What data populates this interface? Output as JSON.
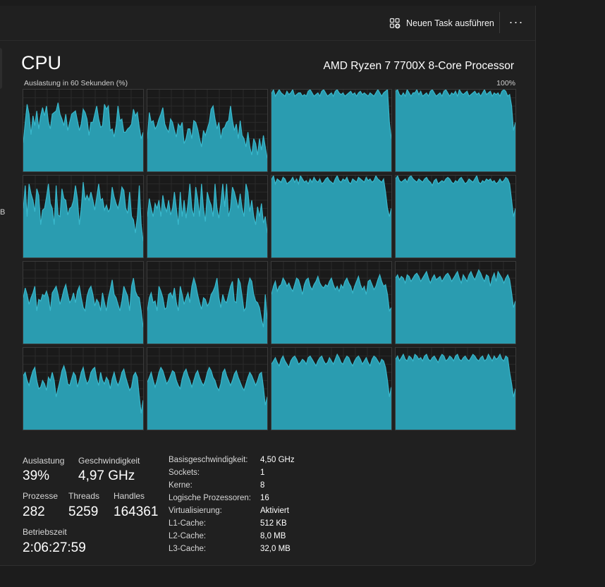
{
  "toolbar": {
    "run_task_label": "Neuen Task ausführen",
    "more_label": "···",
    "run_task_icon": "run-task-icon"
  },
  "sidebar_fragment": "B",
  "page": {
    "title": "CPU",
    "cpu_model": "AMD Ryzen 7 7700X 8-Core Processor",
    "graph_caption": "Auslastung in 60 Sekunden (%)",
    "graph_max": "100%"
  },
  "colors": {
    "graph_fill": "#2a9cb0",
    "graph_line": "#39b8cc",
    "cell_bg": "#1a1a1a",
    "cell_border": "#3a3a3a"
  },
  "chart_data": {
    "type": "area",
    "cores": [
      {
        "values": [
          35,
          60,
          82,
          70,
          45,
          68,
          56,
          74,
          52,
          68,
          78,
          68,
          80,
          60,
          52,
          70,
          72,
          74,
          84,
          70,
          64,
          56,
          70,
          50,
          60,
          70,
          72,
          74,
          62,
          50,
          58,
          76,
          72,
          64,
          44,
          60,
          60,
          70,
          80,
          64,
          54,
          56,
          82,
          76,
          80,
          50,
          52,
          42,
          56,
          80,
          62,
          64,
          48,
          48,
          52,
          54,
          58,
          76,
          68,
          72,
          54,
          40,
          48
        ]
      },
      {
        "values": [
          40,
          72,
          60,
          62,
          52,
          56,
          64,
          70,
          78,
          58,
          52,
          48,
          64,
          60,
          50,
          42,
          58,
          54,
          60,
          34,
          40,
          52,
          52,
          40,
          62,
          60,
          52,
          40,
          30,
          50,
          44,
          52,
          60,
          76,
          80,
          64,
          52,
          60,
          40,
          52,
          54,
          60,
          62,
          80,
          62,
          50,
          58,
          40,
          62,
          44,
          40,
          30,
          48,
          30,
          20,
          40,
          34,
          20,
          40,
          26,
          44,
          30,
          16
        ]
      },
      {
        "values": [
          95,
          100,
          92,
          96,
          100,
          96,
          94,
          92,
          98,
          94,
          96,
          100,
          92,
          94,
          96,
          96,
          92,
          94,
          92,
          98,
          100,
          96,
          92,
          94,
          96,
          92,
          98,
          100,
          96,
          92,
          94,
          96,
          92,
          98,
          100,
          96,
          94,
          96,
          92,
          94,
          96,
          98,
          94,
          96,
          92,
          96,
          98,
          94,
          96,
          94,
          92,
          96,
          94,
          92,
          96,
          100,
          96,
          92,
          96,
          98,
          100,
          60,
          40
        ]
      },
      {
        "values": [
          98,
          100,
          94,
          92,
          96,
          92,
          100,
          96,
          92,
          96,
          96,
          100,
          94,
          98,
          92,
          94,
          96,
          92,
          98,
          100,
          96,
          92,
          94,
          96,
          92,
          98,
          100,
          96,
          92,
          96,
          94,
          98,
          92,
          100,
          96,
          94,
          96,
          98,
          92,
          94,
          96,
          98,
          94,
          96,
          92,
          96,
          100,
          94,
          96,
          98,
          92,
          96,
          94,
          96,
          92,
          98,
          100,
          98,
          92,
          94,
          80,
          50,
          60
        ]
      },
      {
        "values": [
          60,
          88,
          50,
          90,
          78,
          70,
          56,
          84,
          76,
          40,
          58,
          60,
          74,
          90,
          66,
          60,
          40,
          88,
          52,
          50,
          84,
          72,
          70,
          52,
          60,
          62,
          70,
          88,
          72,
          40,
          60,
          92,
          70,
          76,
          70,
          80,
          70,
          58,
          74,
          90,
          70,
          72,
          58,
          64,
          56,
          60,
          86,
          74,
          66,
          60,
          70,
          86,
          82,
          60,
          54,
          80,
          50,
          46,
          30,
          50,
          88,
          40,
          20
        ]
      },
      {
        "values": [
          50,
          72,
          60,
          50,
          66,
          60,
          70,
          50,
          76,
          62,
          56,
          70,
          52,
          60,
          80,
          60,
          40,
          80,
          50,
          70,
          48,
          66,
          90,
          60,
          50,
          86,
          72,
          50,
          90,
          60,
          44,
          80,
          70,
          64,
          50,
          90,
          60,
          48,
          66,
          90,
          62,
          90,
          50,
          60,
          86,
          80,
          70,
          60,
          78,
          60,
          50,
          90,
          80,
          56,
          70,
          50,
          40,
          62,
          50,
          66,
          42,
          50,
          30
        ]
      },
      {
        "values": [
          95,
          100,
          90,
          96,
          94,
          92,
          98,
          96,
          90,
          92,
          94,
          98,
          92,
          96,
          90,
          100,
          96,
          92,
          94,
          90,
          96,
          92,
          98,
          94,
          92,
          96,
          90,
          92,
          96,
          98,
          94,
          92,
          90,
          96,
          100,
          94,
          92,
          96,
          94,
          98,
          92,
          90,
          96,
          94,
          92,
          98,
          96,
          94,
          92,
          98,
          94,
          96,
          92,
          94,
          100,
          96,
          94,
          92,
          96,
          80,
          60,
          50,
          60
        ]
      },
      {
        "values": [
          96,
          100,
          94,
          92,
          94,
          96,
          92,
          98,
          100,
          96,
          94,
          92,
          96,
          94,
          92,
          96,
          98,
          94,
          92,
          88,
          94,
          96,
          90,
          92,
          94,
          92,
          96,
          98,
          96,
          92,
          90,
          94,
          92,
          96,
          98,
          94,
          90,
          92,
          96,
          94,
          92,
          96,
          100,
          92,
          90,
          94,
          92,
          96,
          94,
          96,
          92,
          94,
          90,
          92,
          96,
          92,
          94,
          98,
          96,
          90,
          70,
          50,
          60
        ]
      },
      {
        "values": [
          56,
          68,
          60,
          48,
          56,
          62,
          70,
          40,
          54,
          52,
          60,
          58,
          64,
          56,
          40,
          62,
          66,
          70,
          60,
          48,
          56,
          66,
          72,
          60,
          50,
          54,
          62,
          50,
          64,
          70,
          56,
          44,
          40,
          58,
          66,
          70,
          60,
          46,
          54,
          50,
          40,
          62,
          50,
          40,
          56,
          66,
          78,
          60,
          56,
          48,
          40,
          52,
          70,
          64,
          58,
          40,
          70,
          80,
          64,
          58,
          56,
          40,
          20
        ]
      },
      {
        "values": [
          40,
          56,
          62,
          50,
          52,
          40,
          70,
          64,
          56,
          42,
          44,
          60,
          62,
          56,
          68,
          50,
          40,
          70,
          60,
          48,
          56,
          62,
          50,
          70,
          80,
          72,
          60,
          50,
          42,
          56,
          54,
          46,
          50,
          60,
          64,
          70,
          80,
          56,
          44,
          60,
          52,
          50,
          60,
          70,
          76,
          52,
          50,
          80,
          74,
          58,
          40,
          44,
          70,
          80,
          76,
          60,
          52,
          50,
          44,
          30,
          20,
          60,
          30
        ]
      },
      {
        "values": [
          60,
          70,
          76,
          64,
          70,
          72,
          80,
          76,
          70,
          74,
          68,
          64,
          72,
          80,
          78,
          70,
          60,
          72,
          78,
          80,
          70,
          66,
          72,
          76,
          82,
          74,
          70,
          68,
          72,
          70,
          76,
          80,
          72,
          66,
          70,
          64,
          72,
          68,
          76,
          80,
          74,
          70,
          62,
          70,
          76,
          82,
          72,
          66,
          70,
          60,
          76,
          78,
          72,
          66,
          70,
          78,
          84,
          76,
          70,
          72,
          60,
          40,
          44
        ]
      },
      {
        "values": [
          80,
          84,
          78,
          82,
          80,
          74,
          84,
          82,
          76,
          80,
          84,
          86,
          82,
          76,
          80,
          84,
          88,
          80,
          74,
          80,
          84,
          78,
          80,
          82,
          76,
          80,
          84,
          86,
          82,
          76,
          80,
          84,
          88,
          80,
          74,
          84,
          80,
          76,
          84,
          88,
          82,
          78,
          84,
          90,
          86,
          80,
          76,
          84,
          82,
          70,
          80,
          86,
          76,
          88,
          84,
          80,
          74,
          80,
          84,
          78,
          62,
          44,
          52
        ]
      },
      {
        "values": [
          66,
          70,
          60,
          54,
          64,
          72,
          76,
          60,
          50,
          52,
          60,
          56,
          48,
          64,
          60,
          70,
          60,
          40,
          50,
          60,
          72,
          78,
          70,
          56,
          54,
          62,
          70,
          66,
          52,
          60,
          70,
          76,
          64,
          56,
          60,
          70,
          74,
          76,
          62,
          54,
          70,
          60,
          56,
          64,
          60,
          50,
          62,
          70,
          60,
          54,
          60,
          70,
          74,
          64,
          56,
          48,
          52,
          66,
          70,
          64,
          40,
          20,
          36
        ]
      },
      {
        "values": [
          58,
          64,
          70,
          60,
          52,
          60,
          70,
          76,
          72,
          64,
          56,
          60,
          66,
          72,
          70,
          60,
          54,
          50,
          62,
          70,
          74,
          66,
          60,
          52,
          60,
          68,
          72,
          64,
          58,
          54,
          60,
          70,
          76,
          72,
          64,
          60,
          52,
          48,
          56,
          70,
          74,
          66,
          60,
          54,
          60,
          68,
          72,
          64,
          58,
          52,
          48,
          56,
          64,
          70,
          66,
          60,
          54,
          60,
          68,
          70,
          52,
          30,
          40
        ]
      },
      {
        "values": [
          80,
          84,
          88,
          82,
          78,
          86,
          90,
          84,
          80,
          76,
          84,
          88,
          90,
          86,
          80,
          82,
          86,
          84,
          80,
          88,
          90,
          86,
          82,
          78,
          84,
          88,
          90,
          84,
          80,
          82,
          88,
          84,
          80,
          86,
          92,
          88,
          82,
          80,
          86,
          90,
          88,
          82,
          78,
          84,
          88,
          90,
          86,
          80,
          84,
          88,
          82,
          78,
          86,
          90,
          88,
          84,
          80,
          86,
          84,
          76,
          60,
          40,
          52
        ]
      },
      {
        "values": [
          86,
          90,
          84,
          88,
          92,
          86,
          84,
          90,
          88,
          84,
          92,
          90,
          86,
          88,
          84,
          90,
          92,
          86,
          84,
          88,
          90,
          86,
          82,
          88,
          92,
          90,
          84,
          86,
          90,
          88,
          84,
          90,
          92,
          86,
          84,
          88,
          90,
          86,
          84,
          88,
          92,
          90,
          86,
          84,
          88,
          90,
          84,
          86,
          92,
          88,
          84,
          90,
          86,
          88,
          92,
          86,
          84,
          90,
          88,
          70,
          56,
          40,
          50
        ]
      }
    ]
  },
  "stats": {
    "auslastung": {
      "label": "Auslastung",
      "value": "39%"
    },
    "geschwindigkeit": {
      "label": "Geschwindigkeit",
      "value": "4,97 GHz"
    },
    "prozesse": {
      "label": "Prozesse",
      "value": "282"
    },
    "threads": {
      "label": "Threads",
      "value": "5259"
    },
    "handles": {
      "label": "Handles",
      "value": "164361"
    },
    "betriebszeit": {
      "label": "Betriebszeit",
      "value": "2:06:27:59"
    }
  },
  "details": [
    {
      "label": "Basisgeschwindigkeit:",
      "value": "4,50 GHz"
    },
    {
      "label": "Sockets:",
      "value": "1"
    },
    {
      "label": "Kerne:",
      "value": "8"
    },
    {
      "label": "Logische Prozessoren:",
      "value": "16"
    },
    {
      "label": "Virtualisierung:",
      "value": "Aktiviert"
    },
    {
      "label": "L1-Cache:",
      "value": "512 KB"
    },
    {
      "label": "L2-Cache:",
      "value": "8,0 MB"
    },
    {
      "label": "L3-Cache:",
      "value": "32,0 MB"
    }
  ]
}
